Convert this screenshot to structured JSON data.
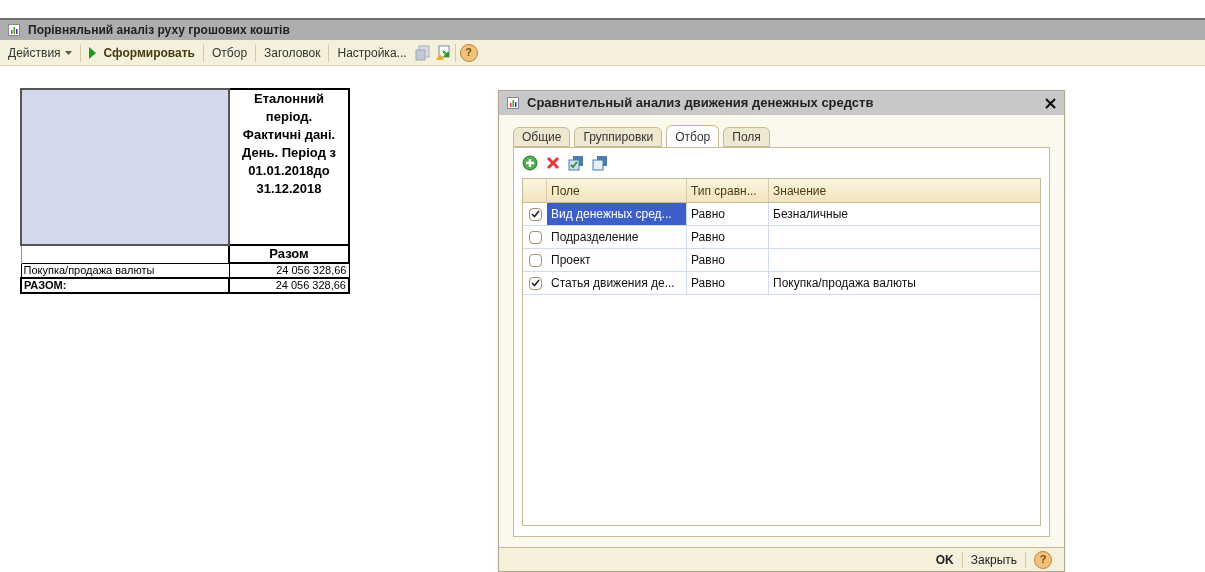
{
  "window": {
    "title": "Порівняльний аналіз руху грошових коштів"
  },
  "toolbar": [
    {
      "kind": "menu",
      "label": "Действия"
    },
    {
      "kind": "run",
      "label": "Сформировать"
    },
    {
      "kind": "text",
      "label": "Отбор"
    },
    {
      "kind": "text",
      "label": "Заголовок"
    },
    {
      "kind": "text",
      "label": "Настройка..."
    },
    {
      "kind": "copy-disabled"
    },
    {
      "kind": "export"
    },
    {
      "kind": "help",
      "label": "?"
    }
  ],
  "report": {
    "header": "Еталонний період. Фактичні дані. День. Період з 01.01.2018до 31.12.2018",
    "column": "Разом",
    "rows": [
      {
        "label": "Покупка/продажа валюты",
        "value": "24 056 328,66",
        "total": false
      },
      {
        "label": "РАЗОМ:",
        "value": "24 056 328,66",
        "total": true
      }
    ]
  },
  "dialog": {
    "title": "Сравнительный анализ движения денежных средств",
    "tabs": [
      {
        "label": "Общие",
        "selected": false
      },
      {
        "label": "Группировки",
        "selected": false
      },
      {
        "label": "Отбор",
        "selected": true
      },
      {
        "label": "Поля",
        "selected": false
      }
    ],
    "columns": [
      "Поле",
      "Тип сравн...",
      "Значение"
    ],
    "rows": [
      {
        "checked": true,
        "selected": true,
        "field": "Вид денежных сред...",
        "comparison": "Равно",
        "value": "Безналичные"
      },
      {
        "checked": false,
        "selected": false,
        "field": "Подразделение",
        "comparison": "Равно",
        "value": ""
      },
      {
        "checked": false,
        "selected": false,
        "field": "Проект",
        "comparison": "Равно",
        "value": ""
      },
      {
        "checked": true,
        "selected": false,
        "field": "Статья движения де...",
        "comparison": "Равно",
        "value": "Покупка/продажа валюты"
      }
    ],
    "buttons": {
      "ok": "OK",
      "close": "Закрыть",
      "help": "?"
    }
  }
}
